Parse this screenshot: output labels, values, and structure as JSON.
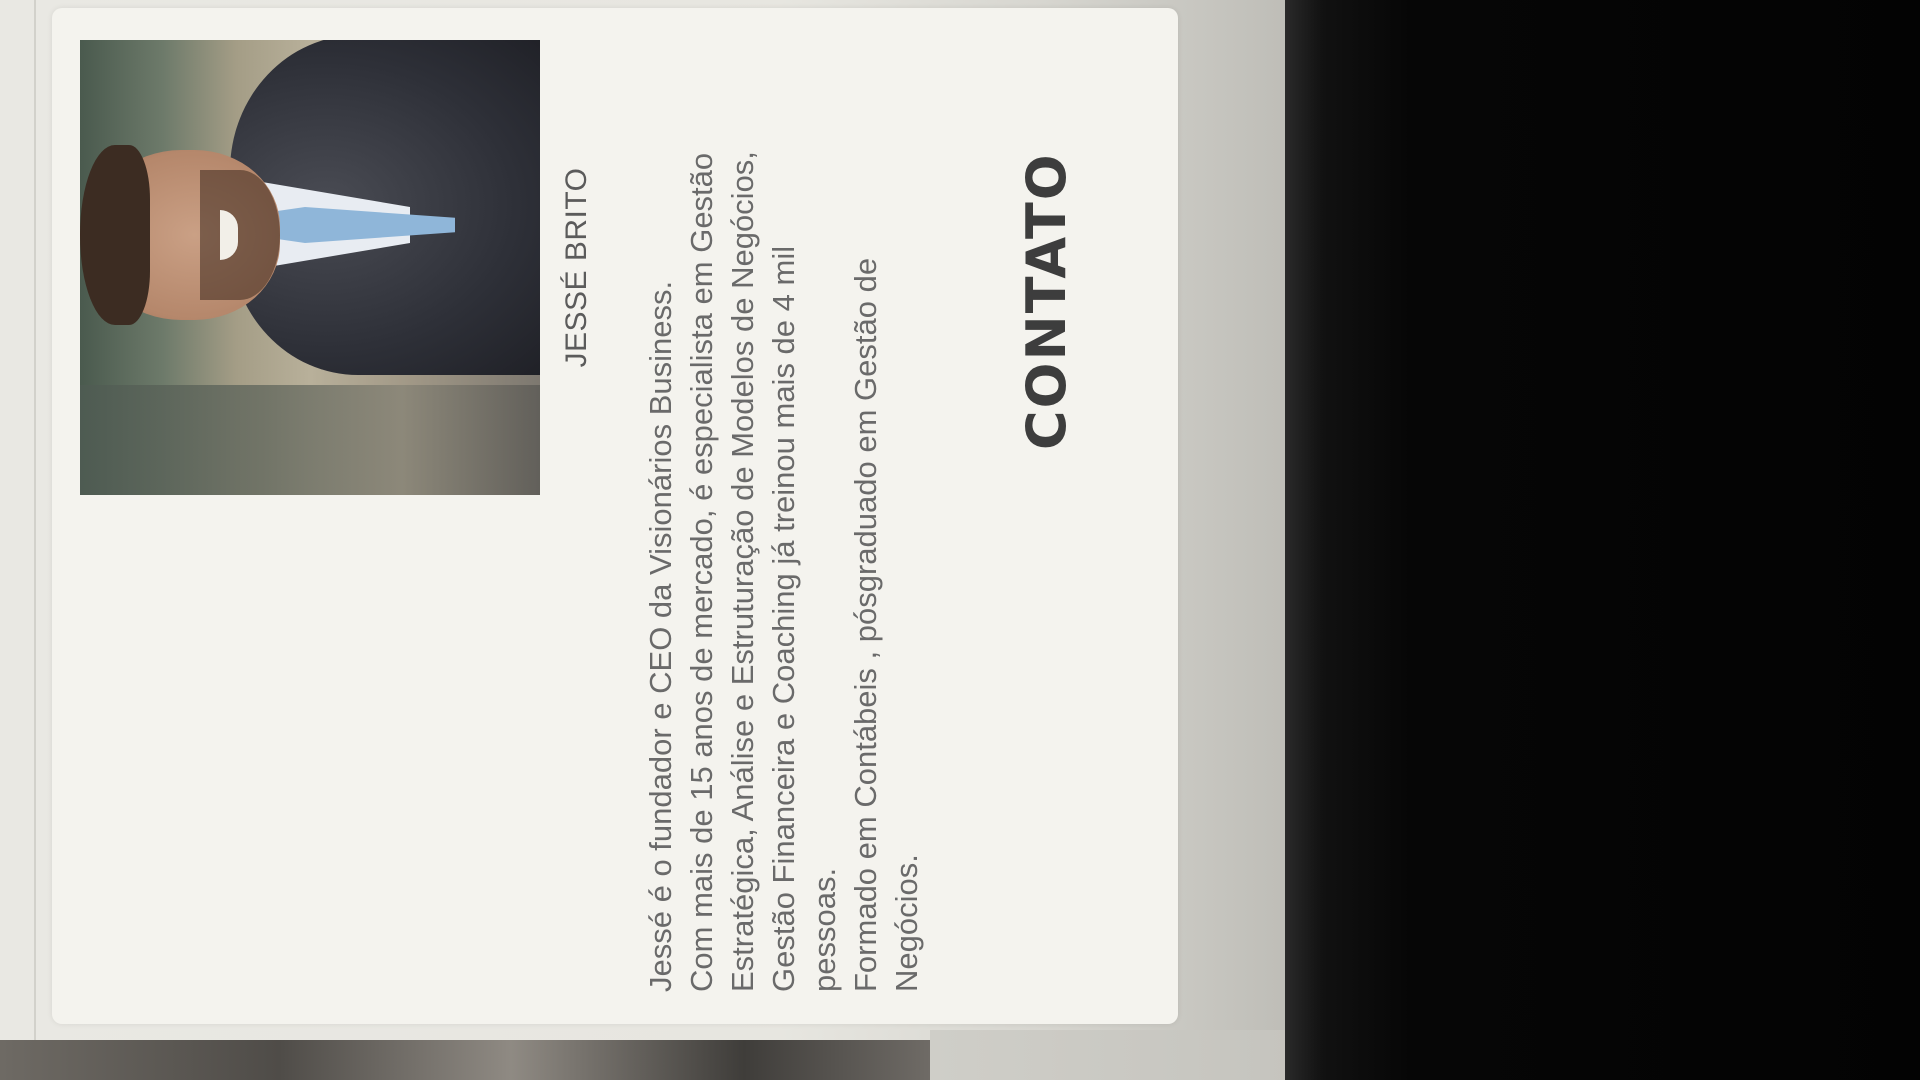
{
  "profile": {
    "name": "JESSÉ BRITO",
    "bio_lines": [
      "Jessé é o fundador e CEO da Visionários Business.",
      "Com mais de 15 anos de mercado, é especialista em Gestão",
      "Estratégica, Análise e Estruturação de Modelos de Negócios,",
      "Gestão Financeira e Coaching já treinou mais de 4 mil",
      "pessoas.",
      "Formado em Contábeis , pósgraduado em Gestão de",
      "Negócios."
    ]
  },
  "sections": {
    "contact_heading": "CONTATO"
  },
  "colors": {
    "card_background": "#f4f3ee",
    "text_gray": "#6a6a6a",
    "heading_dark": "#3d3d3d",
    "tie_blue": "#8fb6d9"
  }
}
